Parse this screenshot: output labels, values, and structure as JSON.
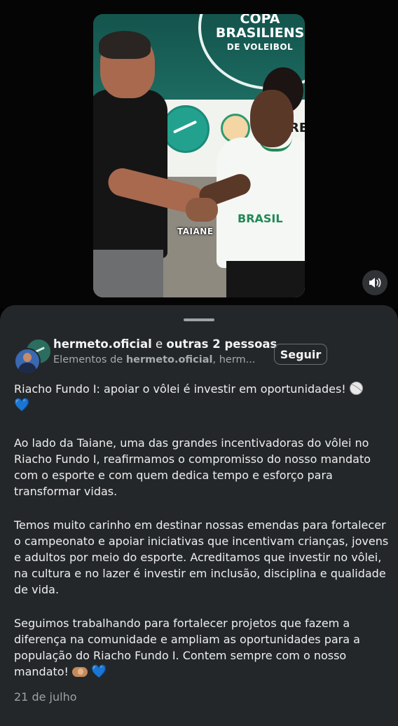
{
  "video": {
    "banner_line1": "COPA",
    "banner_line2": "BRASILIENS",
    "banner_line3": "DE VOLEIBOL",
    "wall_text": "RE",
    "shirt_text": "BRASIL",
    "caption": "TAIANE",
    "mute_icon": "volume-icon"
  },
  "post": {
    "author": "hermeto.oficial",
    "conjunction": " e ",
    "others": "outras 2 pessoas",
    "sub_prefix": "Elementos de ",
    "sub_author": "hermeto.oficial",
    "sub_suffix": ", herm...",
    "follow_label": "Seguir",
    "paragraphs": [
      "Riacho Fundo I: apoiar o vôlei é investir em oportunidades!",
      "Ao lado da Taiane, uma das grandes incentivadoras do vôlei no Riacho Fundo I, reafirmamos o compromisso do nosso mandato com o esporte e com quem dedica tempo e esforço para transformar vidas.",
      "Temos muito carinho em destinar nossas emendas para fortalecer o campeonato e apoiar iniciativas que incentivam crianças, jovens e adultos por meio do esporte. Acreditamos que investir no vôlei, na cultura e no lazer é investir em inclusão, disciplina e qualidade de vida.",
      "Seguimos trabalhando para fortalecer projetos que fazem a diferença na comunidade e ampliam as oportunidades para a população do Riacho Fundo I. Contem sempre com o nosso mandato!"
    ],
    "heart_emoji": "💙",
    "date": "21 de julho"
  },
  "colors": {
    "sheet_bg": "#24272a",
    "text": "#eeeeee",
    "muted": "#a7aaad",
    "heart": "#3c8fe6"
  }
}
